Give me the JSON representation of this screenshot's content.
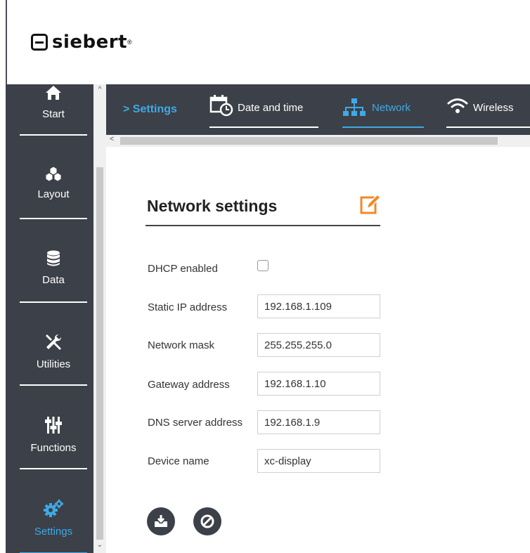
{
  "brand": {
    "logo_text": "siebert",
    "registered": "®"
  },
  "sidebar": {
    "items": [
      {
        "label": "Start",
        "icon": "home-icon"
      },
      {
        "label": "Layout",
        "icon": "cubes-icon"
      },
      {
        "label": "Data",
        "icon": "database-icon"
      },
      {
        "label": "Utilities",
        "icon": "tools-icon"
      },
      {
        "label": "Functions",
        "icon": "sliders-icon"
      },
      {
        "label": "Settings",
        "icon": "gears-icon",
        "active": true
      }
    ]
  },
  "tabbar": {
    "breadcrumb": "> Settings",
    "tabs": [
      {
        "label": "Date and time",
        "icon": "calendar-clock-icon"
      },
      {
        "label": "Network",
        "icon": "network-icon",
        "active": true
      },
      {
        "label": "Wireless",
        "icon": "wifi-icon"
      }
    ]
  },
  "form": {
    "title": "Network settings",
    "dhcp_label": "DHCP enabled",
    "dhcp_checked": false,
    "static_ip_label": "Static IP address",
    "static_ip_value": "192.168.1.109",
    "mask_label": "Network mask",
    "mask_value": "255.255.255.0",
    "gateway_label": "Gateway address",
    "gateway_value": "192.168.1.10",
    "dns_label": "DNS server address",
    "dns_value": "192.168.1.9",
    "device_label": "Device name",
    "device_value": "xc-display"
  },
  "colors": {
    "dark": "#3c4048",
    "accent": "#3fa9e6",
    "edit": "#f08a24"
  }
}
